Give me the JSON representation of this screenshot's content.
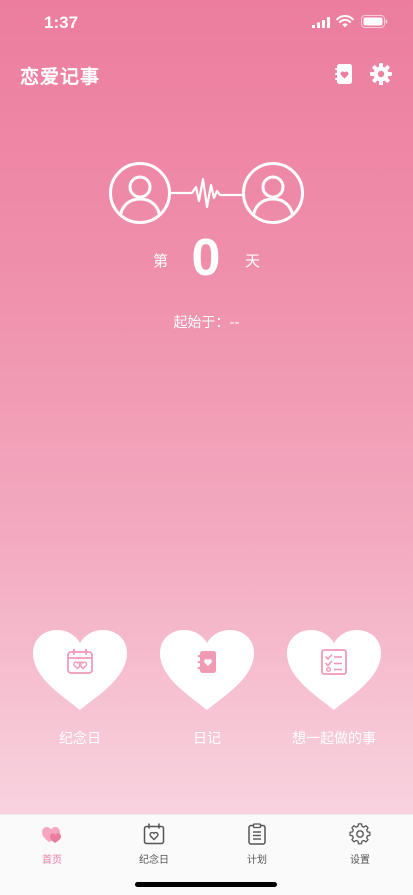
{
  "status_bar": {
    "time": "1:37"
  },
  "header": {
    "title": "恋爱记事",
    "diary_icon": "diary-heart-icon",
    "settings_icon": "gear-icon"
  },
  "counter": {
    "prefix": "第",
    "days": "0",
    "suffix": "天",
    "start_label": "起始于：",
    "start_value": "--"
  },
  "features": [
    {
      "label": "纪念日",
      "icon": "calendar-heart-icon"
    },
    {
      "label": "日记",
      "icon": "diary-heart-icon"
    },
    {
      "label": "想一起做的事",
      "icon": "checklist-icon"
    }
  ],
  "tabs": [
    {
      "label": "首页",
      "icon": "home-heart-icon",
      "active": true
    },
    {
      "label": "纪念日",
      "icon": "calendar-heart-icon",
      "active": false
    },
    {
      "label": "计划",
      "icon": "clipboard-icon",
      "active": false
    },
    {
      "label": "设置",
      "icon": "gear-icon",
      "active": false
    }
  ],
  "colors": {
    "accent": "#ec7d9f",
    "background_top": "#ec7d9f",
    "background_bottom": "#fbe6ec",
    "tab_bar": "#fafafa"
  }
}
